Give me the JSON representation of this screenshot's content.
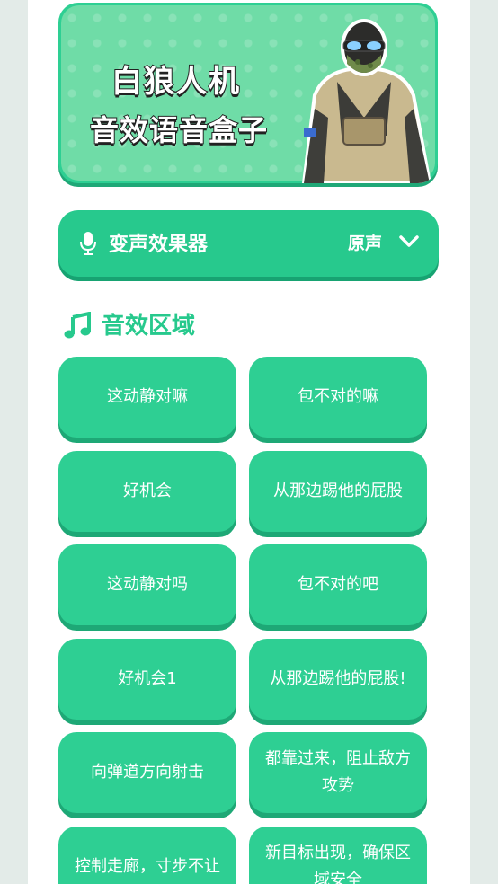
{
  "banner": {
    "title": "白狼人机",
    "subtitle": "音效语音盒子",
    "image": "soldier-avatar"
  },
  "voice_changer": {
    "icon": "microphone-icon",
    "label": "变声效果器",
    "value": "原声",
    "dropdown_icon": "chevron-down-icon"
  },
  "sound_section": {
    "icon": "music-note-icon",
    "title": "音效区域"
  },
  "sounds": [
    {
      "label": "这动静对嘛"
    },
    {
      "label": "包不对的嘛"
    },
    {
      "label": "好机会"
    },
    {
      "label": "从那边踢他的屁股"
    },
    {
      "label": "这动静对吗"
    },
    {
      "label": "包不对的吧"
    },
    {
      "label": "好机会1"
    },
    {
      "label": "从那边踢他的屁股!"
    },
    {
      "label": "向弹道方向射击"
    },
    {
      "label": "都靠过来，阻止敌方攻势"
    },
    {
      "label": "控制走廊，寸步不让"
    },
    {
      "label": "新目标出现，确保区域安全"
    }
  ],
  "colors": {
    "accent": "#27c98d",
    "button": "#2ecf93",
    "button_shadow": "#1ea876",
    "page_bg": "#e3ebe8"
  }
}
